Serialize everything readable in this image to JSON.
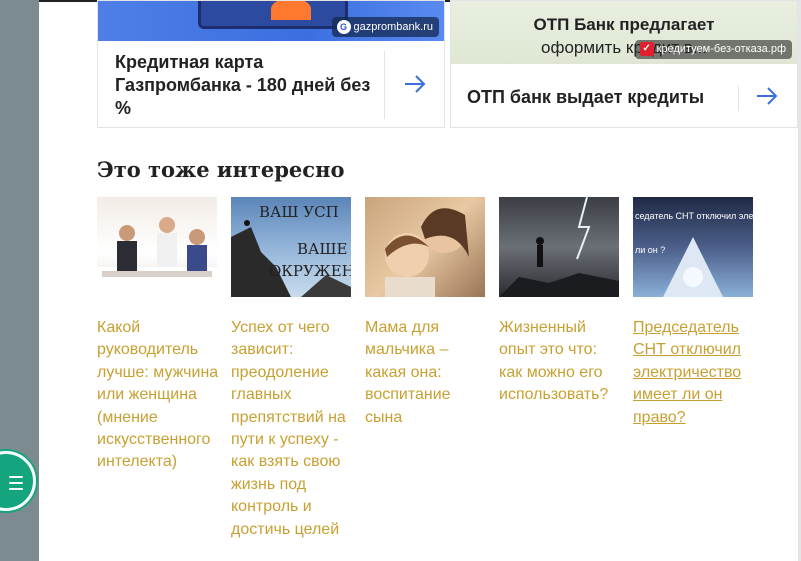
{
  "ads": [
    {
      "source": "gazprombank.ru",
      "title": "Кредитная карта Газпромбанка - 180 дней без %",
      "accent": "#3b6fe0"
    },
    {
      "banner_line1": "ОТП Банк предлагает",
      "banner_line2": "оформить кредит в...",
      "source": "кредитуем-без-отказа.рф",
      "title": "ОТП банк выдает кредиты",
      "accent": "#3b6fe0"
    }
  ],
  "section": {
    "title": "Это тоже интересно"
  },
  "articles": [
    {
      "title": "Какой руководитель лучше: мужчина или женщина (мнение искусственного интелекта)"
    },
    {
      "title": "Успех от чего зависит: преодоление главных препятствий на пути к успеху - как взять свою жизнь под контроль и достичь целей",
      "thumb_text1": "ВАШ УСП",
      "thumb_text2": "ВАШЕ",
      "thumb_text3": "ОКРУЖЕН"
    },
    {
      "title": "Мама для мальчика – какая она: воспитание сына"
    },
    {
      "title": "Жизненный опыт это что: как можно его использовать?"
    },
    {
      "title": "Председатель СНТ отключил электричество имеет ли он право?",
      "thumb_text1": "седатель СНТ отключил электрича",
      "thumb_text2": "ли он ?"
    }
  ],
  "colors": {
    "link": "#c8a032",
    "rail": "#7b8b90",
    "chat": "#14a57e"
  }
}
